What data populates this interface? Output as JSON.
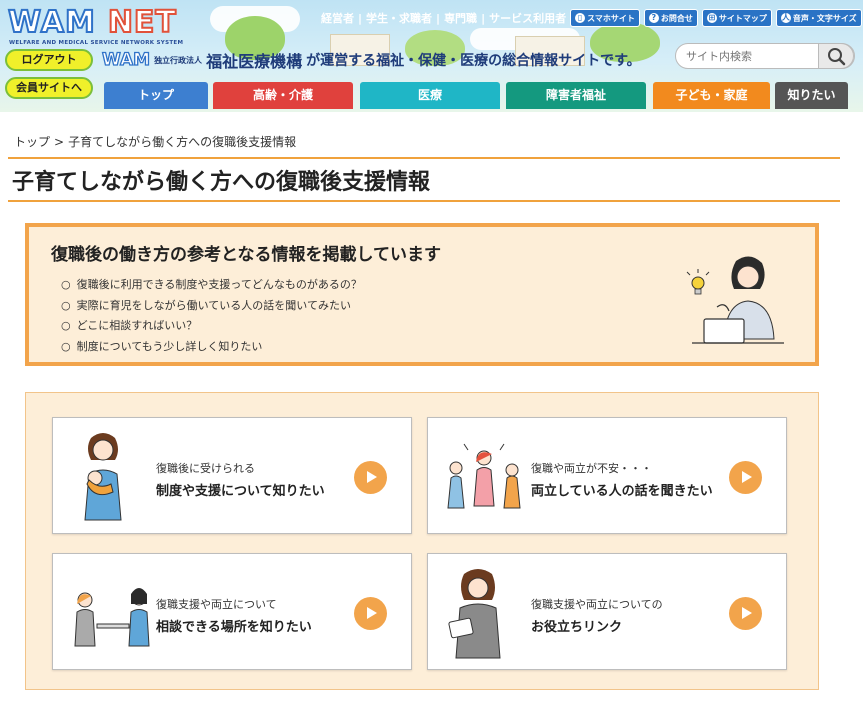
{
  "header": {
    "logo": {
      "w": "WAM",
      "n": "NET",
      "tagline": "WELFARE AND MEDICAL SERVICE NETWORK SYSTEM"
    },
    "top_links": [
      "経営者",
      "学生・求職者",
      "専門職",
      "サービス利用者"
    ],
    "chips": [
      {
        "icon": "smartphone-icon",
        "label": "スマホサイト"
      },
      {
        "icon": "question-icon",
        "label": "お問合せ"
      },
      {
        "icon": "sitemap-icon",
        "label": "サイトマップ"
      },
      {
        "icon": "accessibility-icon",
        "label": "音声・文字サイズ"
      }
    ],
    "logout_label": "ログアウト",
    "member_label": "会員サイトへ",
    "org": {
      "wam": "WAM",
      "small": "独立行政法人",
      "name": "福祉医療機構",
      "tail": "が運営する福祉・保健・医療の総合情報サイトです。"
    },
    "search_placeholder": "サイト内検索"
  },
  "nav": [
    {
      "label": "トップ",
      "color": "#3d7fd0"
    },
    {
      "label": "高齢・介護",
      "color": "#e0413d"
    },
    {
      "label": "医療",
      "color": "#1fb6c6"
    },
    {
      "label": "障害者福祉",
      "color": "#14997f"
    },
    {
      "label": "子ども・家庭",
      "color": "#f28a1e"
    },
    {
      "label": "知りたい",
      "color": "#555555"
    }
  ],
  "breadcrumb": {
    "home": "トップ",
    "arrow": ">",
    "current": "子育てしながら働く方への復職後支援情報"
  },
  "page_title": "子育てしながら働く方への復職後支援情報",
  "intro": {
    "heading": "復職後の働き方の参考となる情報を掲載しています",
    "items": [
      "復職後に利用できる制度や支援ってどんなものがあるの？",
      "実際に育児をしながら働いている人の話を聞いてみたい",
      "どこに相談すればいい？",
      "制度についてもう少し詳しく知りたい"
    ]
  },
  "cards": [
    {
      "sub": "復職後に受けられる",
      "main": "制度や支援について知りたい"
    },
    {
      "sub": "復職や両立が不安・・・",
      "main": "両立している人の話を聞きたい"
    },
    {
      "sub": "復職支援や両立について",
      "main": "相談できる場所を知りたい"
    },
    {
      "sub": "復職支援や両立についての",
      "main": "お役立ちリンク"
    }
  ],
  "colors": {
    "accent": "#f2a44b",
    "panel": "#fdeed8",
    "header_sky": "#bfe3f4"
  }
}
